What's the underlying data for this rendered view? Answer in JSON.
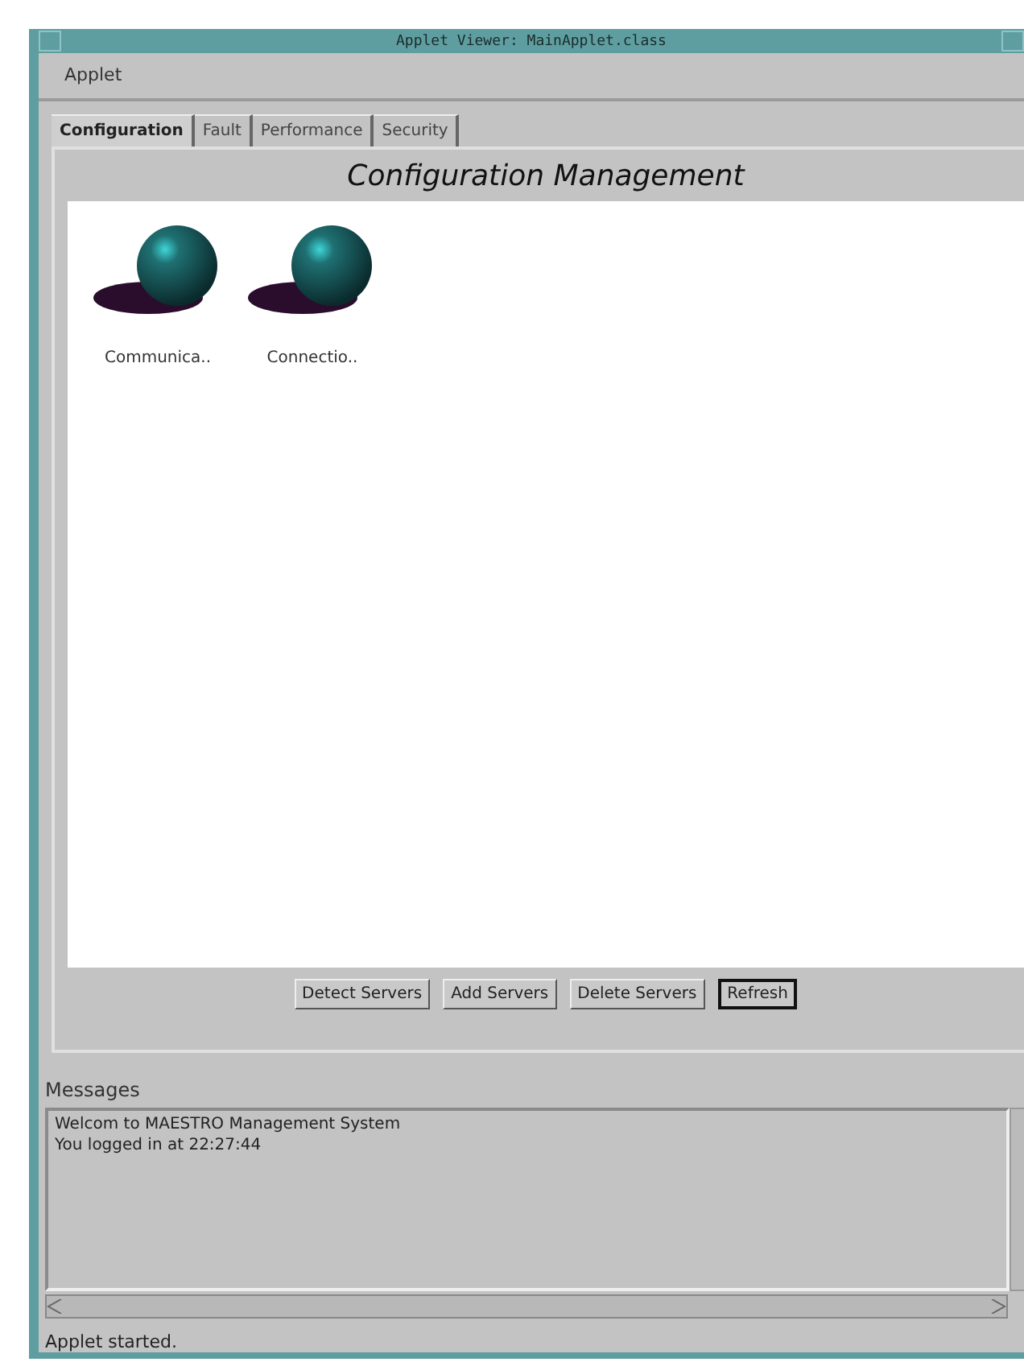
{
  "window": {
    "title": "Applet Viewer: MainApplet.class"
  },
  "menu": [
    "Applet"
  ],
  "tabs": [
    {
      "label": "Configuration",
      "selected": true
    },
    {
      "label": "Fault",
      "selected": false
    },
    {
      "label": "Performance",
      "selected": false
    },
    {
      "label": "Security",
      "selected": false
    }
  ],
  "panel": {
    "title": "Configuration Management",
    "items": [
      {
        "label": "Communica.."
      },
      {
        "label": "Connectio.."
      }
    ],
    "buttons": [
      {
        "label": "Detect Servers",
        "default": false
      },
      {
        "label": "Add Servers",
        "default": false
      },
      {
        "label": "Delete Servers",
        "default": false
      },
      {
        "label": "Refresh",
        "default": true
      }
    ]
  },
  "messages": {
    "label": "Messages",
    "lines": [
      "Welcom to MAESTRO Management System",
      "You logged in at 22:27:44"
    ]
  },
  "status_bar": "Applet started."
}
